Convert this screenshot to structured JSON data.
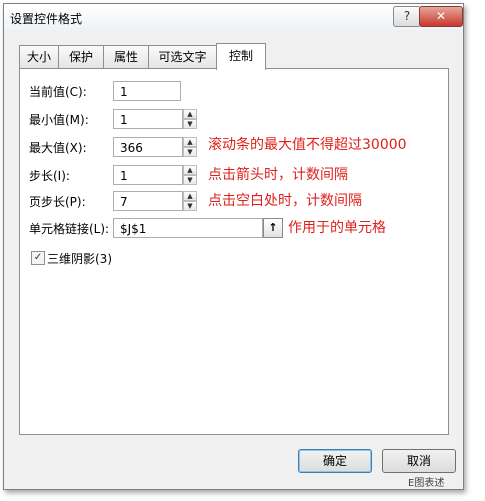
{
  "dialog": {
    "title": "设置控件格式",
    "help_glyph": "?",
    "close_glyph": "✕"
  },
  "tabs": [
    "大小",
    "保护",
    "属性",
    "可选文字",
    "控制"
  ],
  "fields": {
    "current_value": {
      "label": "当前值(C):",
      "value": "1"
    },
    "min_value": {
      "label": "最小值(M):",
      "value": "1"
    },
    "max_value": {
      "label": "最大值(X):",
      "value": "366"
    },
    "step": {
      "label": "步长(I):",
      "value": "1"
    },
    "page_step": {
      "label": "页步长(P):",
      "value": "7"
    },
    "cell_link": {
      "label": "单元格链接(L):",
      "value": "$J$1"
    }
  },
  "notes": {
    "max": "滚动条的最大值不得超过30000",
    "step": "点击箭头时，计数间隔",
    "page_step": "点击空白处时，计数间隔",
    "link": "作用于的单元格"
  },
  "checkbox": {
    "label": "三维阴影(3)",
    "checked": true
  },
  "buttons": {
    "ok": "确定",
    "cancel": "取消"
  },
  "watermark": "E图表述",
  "colors": {
    "annotation": "#e0201a"
  }
}
